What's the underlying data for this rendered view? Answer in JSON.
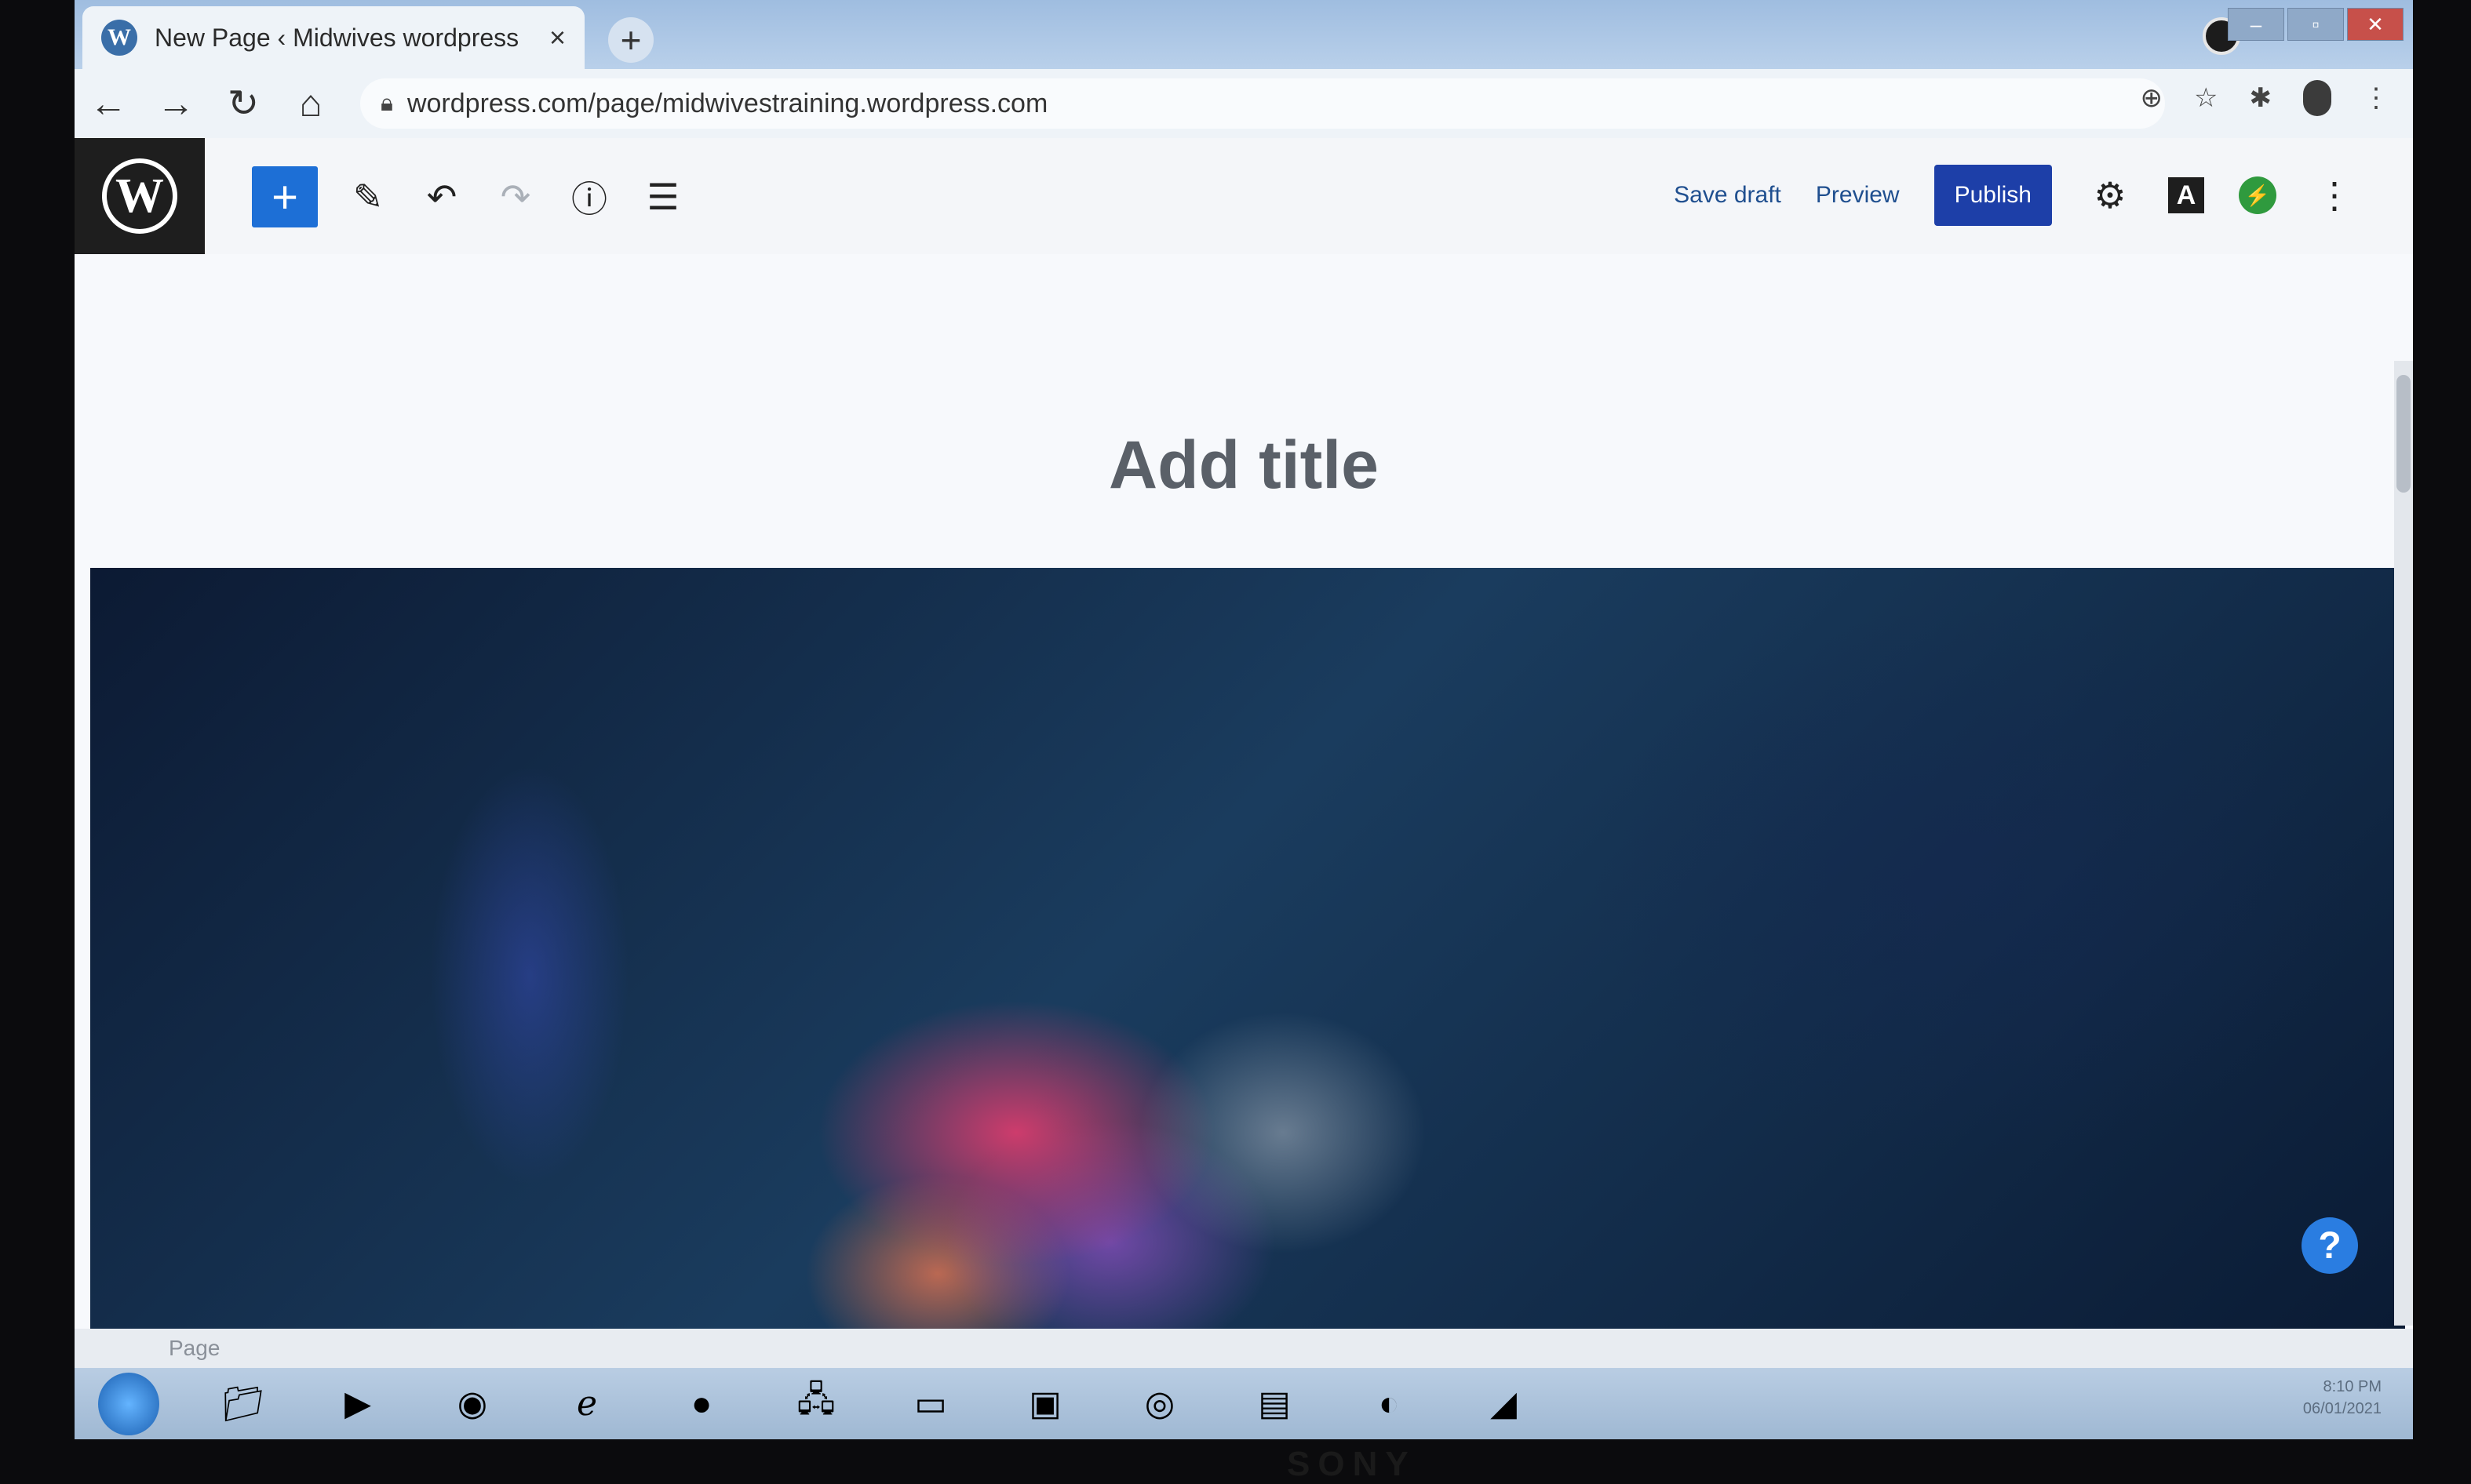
{
  "browser": {
    "tab_title": "New Page ‹ Midwives wordpress",
    "tab_close": "×",
    "new_tab": "+",
    "url": "wordpress.com/page/midwivestraining.wordpress.com"
  },
  "editor": {
    "inserter_label": "+",
    "save_draft": "Save draft",
    "preview": "Preview",
    "publish": "Publish",
    "font_icon_letter": "A",
    "title_placeholder": "Add title",
    "help_label": "?",
    "breadcrumb": "Page"
  },
  "tray": {
    "time": "8:10 PM",
    "date": "06/01/2021"
  },
  "monitor": {
    "brand": "SONY"
  },
  "colors": {
    "publish": "#1d3fa8",
    "inserter": "#1d6fd6",
    "wp_sidebar": "#1e1e1e"
  }
}
